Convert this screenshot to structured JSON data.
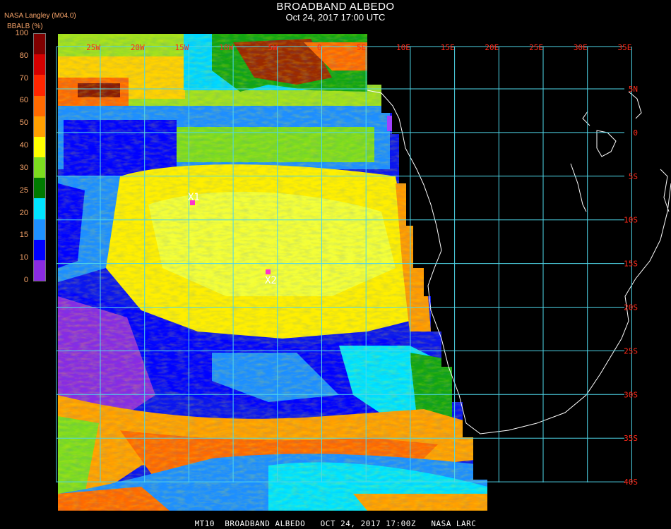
{
  "header": {
    "title": "BROADBAND ALBEDO",
    "subtitle": "Oct 24, 2017 17:00 UTC",
    "source": "NASA Langley (M04.0)",
    "variable": "BBALB (%)"
  },
  "legend": {
    "ticks": [
      "100",
      "80",
      "70",
      "60",
      "50",
      "40",
      "30",
      "25",
      "20",
      "15",
      "10",
      "0"
    ],
    "colors": [
      "#7f0000",
      "#d40000",
      "#ff2600",
      "#ff6a00",
      "#ff9f00",
      "#ffff00",
      "#7ddc1f",
      "#007a00",
      "#00e4ff",
      "#1e90ff",
      "#0000ff",
      "#8a2be2"
    ]
  },
  "grid": {
    "lon_labels": [
      "25W",
      "20W",
      "15W",
      "10W",
      "5W",
      "0",
      "5E",
      "10E",
      "15E",
      "20E",
      "25E",
      "30E",
      "35E"
    ],
    "lat_labels": [
      "5N",
      "0",
      "5S",
      "10S",
      "15S",
      "20S",
      "25S",
      "30S",
      "35S",
      "40S"
    ],
    "line_color": "#4fd7ea",
    "label_color": "#ff2a1a"
  },
  "markers": [
    {
      "label": "X1",
      "color": "#ff33cc"
    },
    {
      "label": "X2",
      "color": "#ff33cc"
    }
  ],
  "footer": "MT10  BROADBAND ALBEDO   OCT 24, 2017 17:00Z   NASA LARC"
}
